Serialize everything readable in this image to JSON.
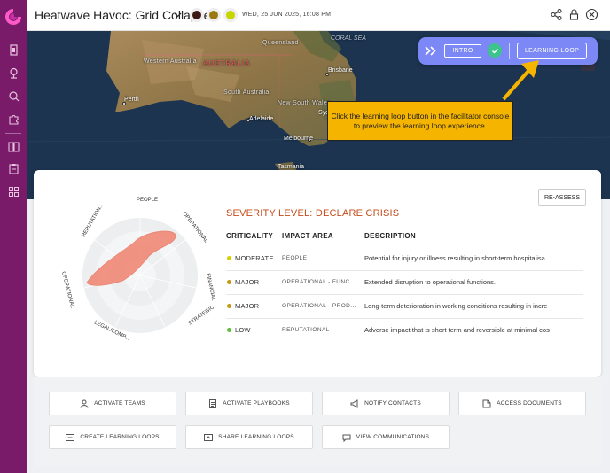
{
  "header": {
    "title": "Heatwave Havoc: Grid Collapse",
    "datetime": "WED, 25 JUN 2025, 16:08 PM",
    "status_dots": [
      "#3d1b14",
      "#9a7a10",
      "#c8d600"
    ]
  },
  "sidebar": {
    "items": [
      "dashboard-icon",
      "location-icon",
      "map-search-icon",
      "puzzle-icon",
      "book-icon",
      "clipboard-icon",
      "apps-icon"
    ]
  },
  "map": {
    "labels": {
      "queensland": "Queensland",
      "coral_sea": "CORAL SEA",
      "western_australia": "Western Australia",
      "australia": "AUSTRALIA",
      "brisbane": "Brisbane",
      "perth": "Perth",
      "south_australia": "South Australia",
      "new_south_wales": "New South Wales",
      "adelaide": "Adelaide",
      "sydney": "Syd",
      "melbourne": "Melbourne",
      "tasmania": "Tasmania"
    }
  },
  "console": {
    "intro_label": "INTRO",
    "learning_loop_label": "LEARNING LOOP"
  },
  "callout": {
    "text": "Click the learning loop button in the facilitator console to preview the learning loop experience."
  },
  "severity": {
    "reassess_label": "RE-ASSESS",
    "title": "SEVERITY LEVEL: DECLARE CRISIS",
    "columns": [
      "CRITICALITY",
      "IMPACT AREA",
      "DESCRIPTION"
    ],
    "rows": [
      {
        "criticality": "MODERATE",
        "impact_area": "PEOPLE",
        "description": "Potential for injury or illness resulting in short-term hospitalisa",
        "color": "#d4d300"
      },
      {
        "criticality": "MAJOR",
        "impact_area": "OPERATIONAL - FUNC...",
        "description": "Extended disruption to operational functions.",
        "color": "#c49a12"
      },
      {
        "criticality": "MAJOR",
        "impact_area": "OPERATIONAL - PROD...",
        "description": "Long-term deterioration in working conditions resulting in incre",
        "color": "#c49a12"
      },
      {
        "criticality": "LOW",
        "impact_area": "REPUTATIONAL",
        "description": "Adverse impact that is short term and reversible at minimal cos",
        "color": "#5fbf3a"
      }
    ],
    "radar_axes": [
      "PEOPLE",
      "OPERATIONAL",
      "FINANCIAL",
      "STRATEGIC",
      "LEGAL/COMP...",
      "OPERATIONAL",
      "REPUTATION..."
    ]
  },
  "actions": {
    "activate_teams": "ACTIVATE TEAMS",
    "activate_playbooks": "ACTIVATE PLAYBOOKS",
    "notify_contacts": "NOTIFY CONTACTS",
    "access_documents": "ACCESS DOCUMENTS",
    "create_learning_loops": "CREATE LEARNING LOOPS",
    "share_learning_loops": "SHARE LEARNING LOOPS",
    "view_communications": "VIEW COMMUNICATIONS"
  }
}
